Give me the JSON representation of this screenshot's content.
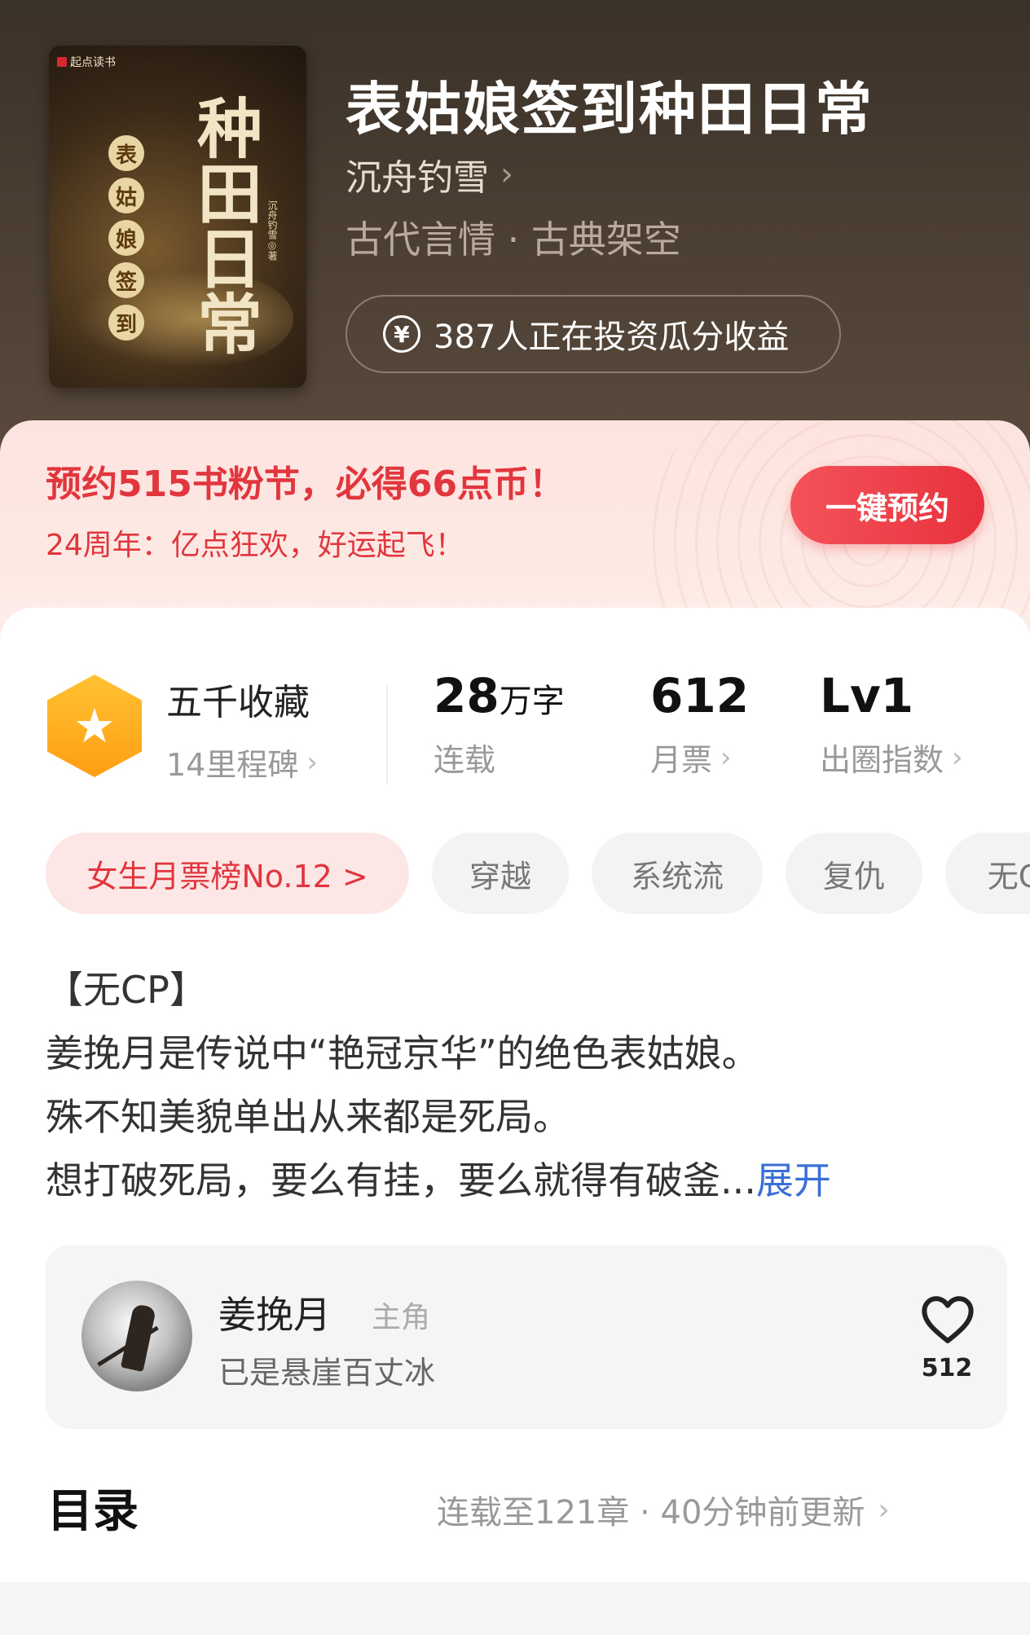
{
  "book": {
    "title": "表姑娘签到种田日常",
    "author": "沉舟钓雪",
    "genre": "古代言情 · 古典架空",
    "invest_text": "387人正在投资瓜分收益"
  },
  "cover": {
    "brand": "起点读书",
    "title_vertical": "种田日常",
    "subtitle_chars": [
      "表",
      "姑",
      "娘",
      "签",
      "到"
    ],
    "author_vertical": "沉舟钓雪◎著"
  },
  "promo": {
    "title": "预约515书粉节，必得66点币！",
    "subtitle": "24周年：亿点狂欢，好运起飞！",
    "button_label": "一键预约",
    "accent_color": "#e2363f"
  },
  "stats": {
    "collect_title": "五千收藏",
    "collect_sub": "14里程碑",
    "words_num": "28",
    "words_unit": "万字",
    "words_label": "连载",
    "tickets_num": "612",
    "tickets_label": "月票",
    "level_num": "Lv1",
    "level_label": "出圈指数"
  },
  "tags": [
    "女生月票榜No.12 >",
    "穿越",
    "系统流",
    "复仇",
    "无C"
  ],
  "description": {
    "lines": [
      "【无CP】",
      "姜挽月是传说中“艳冠京华”的绝色表姑娘。",
      "殊不知美貌单出从来都是死局。",
      "想打破死局，要么有挂，要么就得有破釜..."
    ],
    "more_label": "展开"
  },
  "character": {
    "name": "姜挽月",
    "role": "主角",
    "quote": "已是悬崖百丈冰",
    "likes": "512"
  },
  "toc": {
    "title": "目录",
    "info": "连载至121章 · 40分钟前更新"
  }
}
